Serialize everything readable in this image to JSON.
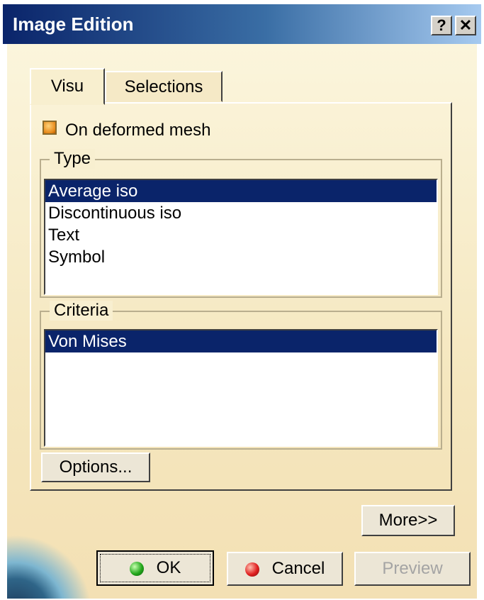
{
  "window": {
    "title": "Image Edition",
    "help_glyph": "?",
    "close_glyph": "✕"
  },
  "tabs": [
    {
      "label": "Visu",
      "active": true
    },
    {
      "label": "Selections",
      "active": false
    }
  ],
  "visu": {
    "deformed_mesh": {
      "label": "On deformed mesh",
      "checked": true
    },
    "type_group": {
      "legend": "Type",
      "items": [
        "Average iso",
        "Discontinuous iso",
        "Text",
        "Symbol"
      ],
      "selected": "Average iso"
    },
    "criteria_group": {
      "legend": "Criteria",
      "items": [
        "Von Mises"
      ],
      "selected": "Von Mises"
    },
    "options_label": "Options..."
  },
  "buttons": {
    "more": "More>>",
    "ok": "OK",
    "cancel": "Cancel",
    "preview": "Preview"
  },
  "icons": {
    "ok": "green-led-icon",
    "cancel": "red-led-icon",
    "help": "question-mark-icon",
    "close": "close-icon"
  },
  "colors": {
    "title_bar": "#0a246a",
    "selection": "#0a246a",
    "dialog_background": "#f8efcf"
  }
}
